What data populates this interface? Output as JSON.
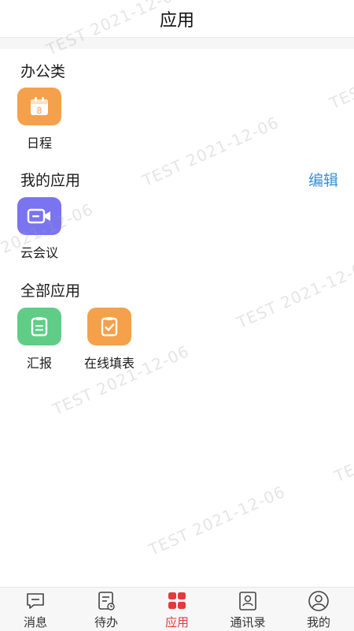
{
  "header": {
    "title": "应用"
  },
  "sections": [
    {
      "title": "办公类",
      "apps": [
        {
          "label": "日程",
          "icon": "calendar-icon",
          "color": "#f5a04a"
        }
      ]
    },
    {
      "title": "我的应用",
      "action": "编辑",
      "apps": [
        {
          "label": "云会议",
          "icon": "video-camera-icon",
          "color": "#7b74f0"
        }
      ]
    },
    {
      "title": "全部应用",
      "apps": [
        {
          "label": "汇报",
          "icon": "report-icon",
          "color": "#5fcd86"
        },
        {
          "label": "在线填表",
          "icon": "clipboard-check-icon",
          "color": "#f5a04a"
        }
      ]
    }
  ],
  "calendar_day": "8",
  "tabs": [
    {
      "label": "消息",
      "icon": "message-icon"
    },
    {
      "label": "待办",
      "icon": "todo-icon"
    },
    {
      "label": "应用",
      "icon": "apps-grid-icon",
      "active": true
    },
    {
      "label": "通讯录",
      "icon": "contacts-icon"
    },
    {
      "label": "我的",
      "icon": "profile-icon"
    }
  ],
  "watermark": "TEST 2021-12-06",
  "colors": {
    "active_tab": "#e23b3b",
    "link": "#3a8fd0"
  }
}
